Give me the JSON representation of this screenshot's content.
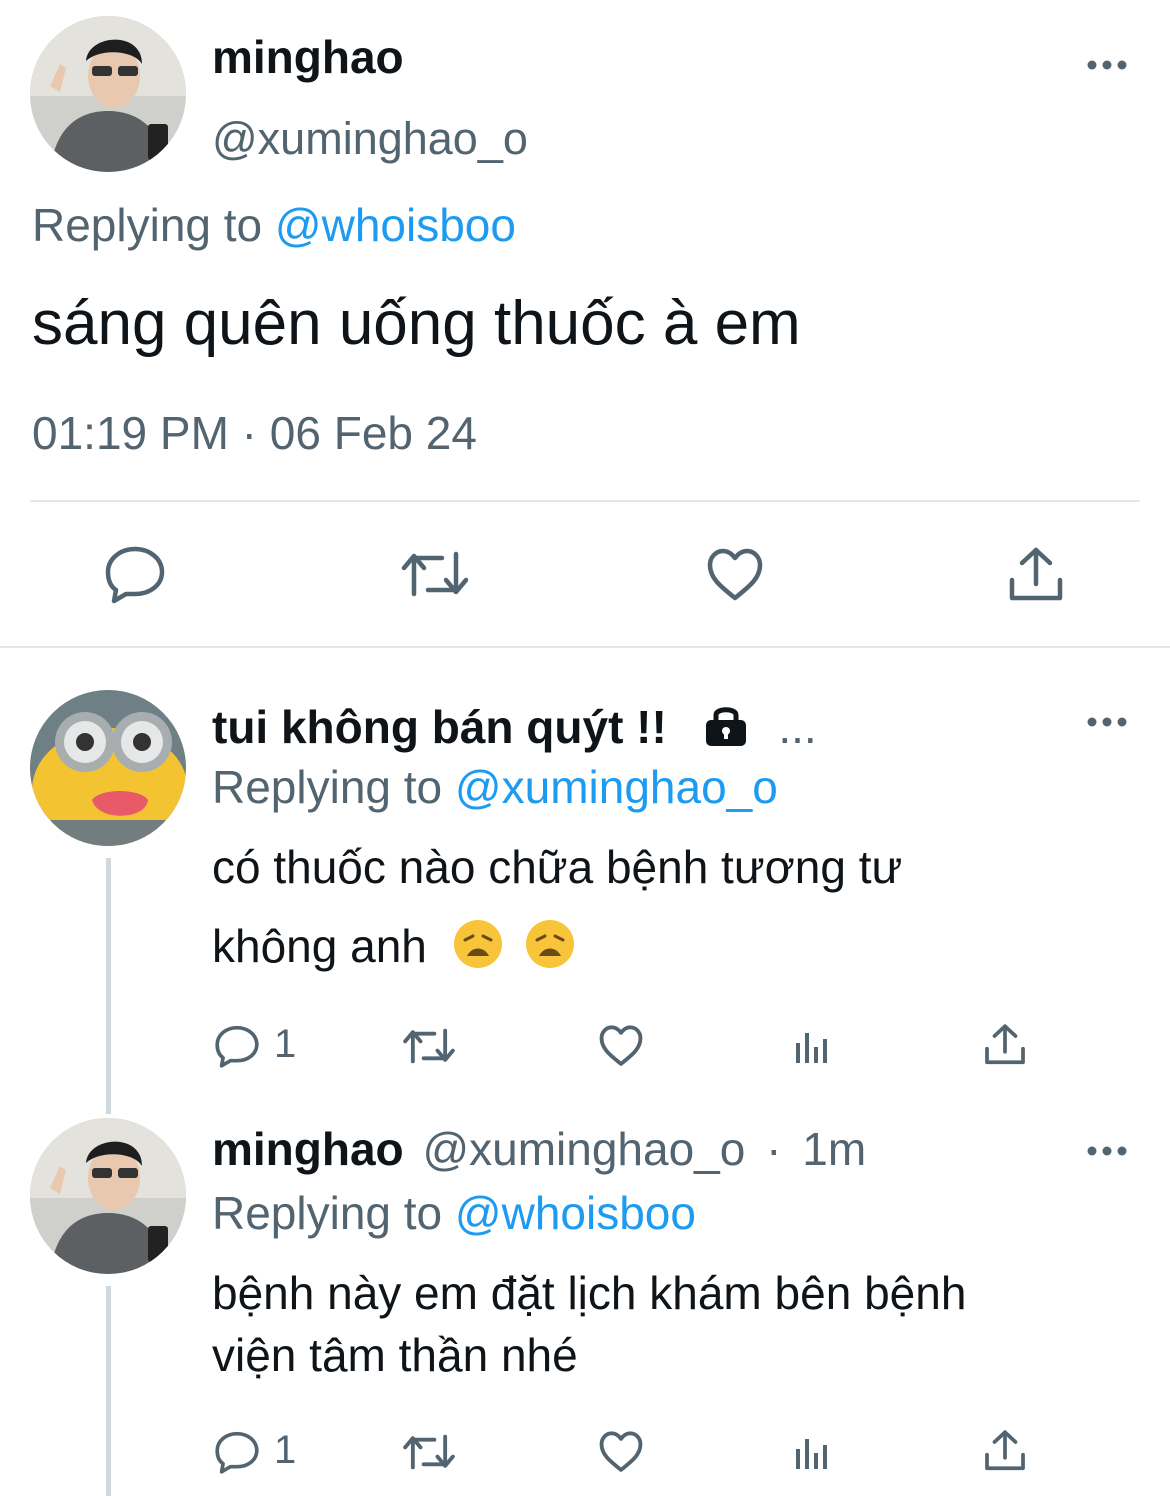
{
  "main_tweet": {
    "display_name": "minghao",
    "handle": "@xuminghao_o",
    "replying_prefix": "Replying to ",
    "replying_to": "@whoisboo",
    "text": "sáng quên uống thuốc à em",
    "timestamp": "01:19 PM · 06 Feb 24",
    "actions": [
      "reply-icon",
      "retweet-icon",
      "like-icon",
      "share-icon"
    ]
  },
  "replies": [
    {
      "display_name": "tui không bán quýt !!",
      "name_truncation": "...",
      "replying_prefix": "Replying to ",
      "replying_to": "@xuminghao_o",
      "text_line1": "có thuốc nào chữa bệnh tương tư",
      "text_line2": "không anh",
      "reply_count": "1"
    },
    {
      "display_name": "minghao",
      "handle": "@xuminghao_o",
      "separator": "·",
      "time": "1m",
      "replying_prefix": "Replying to ",
      "replying_to": "@whoisboo",
      "text_line1": "bệnh này em đặt lịch khám bên bệnh",
      "text_line2": "viện tâm thần nhé",
      "reply_count": "1"
    }
  ],
  "colors": {
    "text": "#0f1419",
    "secondary": "#536471",
    "link": "#1d9bf0",
    "divider": "#e1e8ed"
  }
}
